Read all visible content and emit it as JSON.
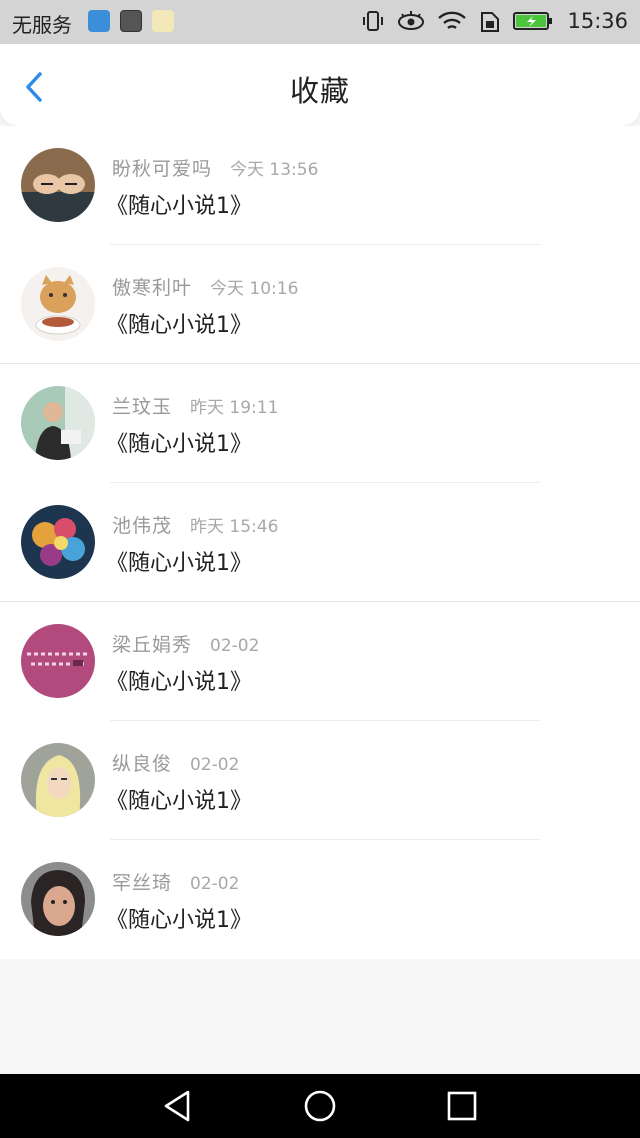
{
  "status_bar": {
    "carrier": "无服务",
    "time": "15:36",
    "icons": [
      "wifi-app-icon",
      "photo-app-icon",
      "wechat-app-icon",
      "vibrate-icon",
      "eye-icon",
      "wifi-icon",
      "sim-icon",
      "battery-icon"
    ]
  },
  "header": {
    "title": "收藏",
    "back_icon": "chevron-left-icon",
    "accent_color": "#2f8be8"
  },
  "favorites": [
    {
      "name": "盼秋可爱吗",
      "time": "今天 13:56",
      "book": "《随心小说1》"
    },
    {
      "name": "傲寒利叶",
      "time": "今天 10:16",
      "book": "《随心小说1》"
    },
    {
      "name": "兰玟玉",
      "time": "昨天 19:11",
      "book": "《随心小说1》"
    },
    {
      "name": "池伟茂",
      "time": "昨天 15:46",
      "book": "《随心小说1》"
    },
    {
      "name": "梁丘娟秀",
      "time": "02-02",
      "book": "《随心小说1》"
    },
    {
      "name": "纵良俊",
      "time": "02-02",
      "book": "《随心小说1》"
    },
    {
      "name": "罕丝琦",
      "time": "02-02",
      "book": "《随心小说1》"
    }
  ],
  "nav_bar": {
    "icons": [
      "nav-back-icon",
      "nav-home-icon",
      "nav-recent-icon"
    ]
  }
}
